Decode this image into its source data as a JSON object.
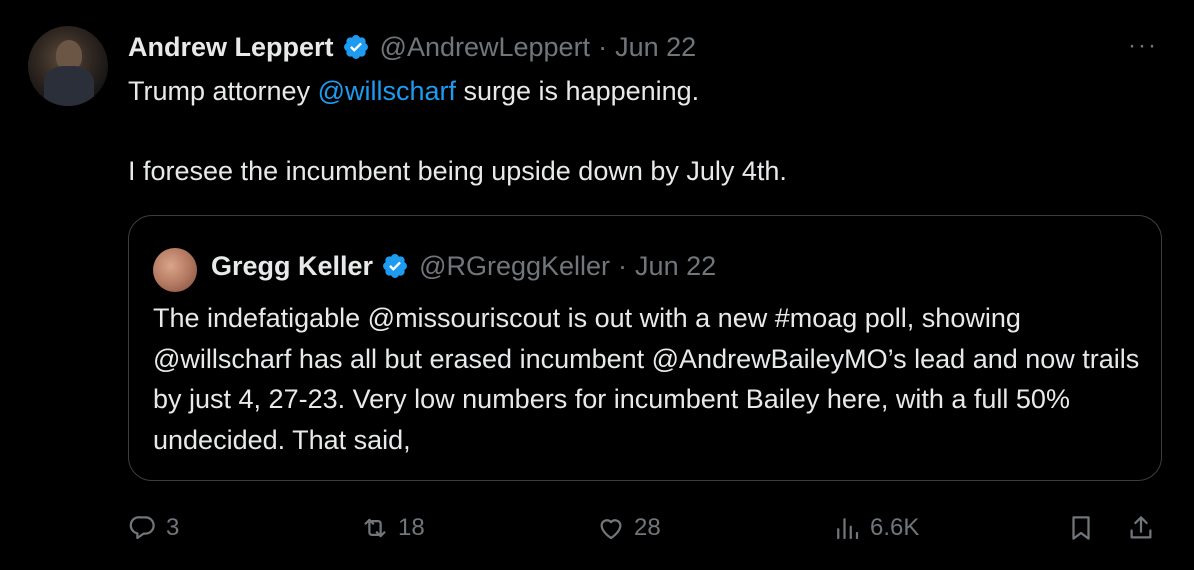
{
  "tweet": {
    "author_name": "Andrew Leppert",
    "author_handle": "@AndrewLeppert",
    "separator": "·",
    "date": "Jun 22",
    "more_icon": "more-icon",
    "text_line1_prefix": "Trump attorney ",
    "text_line1_mention": "@willscharf",
    "text_line1_suffix": " surge is happening.",
    "text_line2": "I foresee the incumbent being upside down by July 4th."
  },
  "quote": {
    "author_name": "Gregg Keller",
    "author_handle": "@RGreggKeller",
    "separator": "·",
    "date": "Jun 22",
    "text": "The indefatigable @missouriscout is out with a new #moag poll, showing @willscharf has all but erased incumbent @AndrewBaileyMO’s lead and now trails by just 4, 27-23. Very low numbers for incumbent Bailey here, with a full 50% undecided. That said,"
  },
  "actions": {
    "replies": "3",
    "reposts": "18",
    "likes": "28",
    "views": "6.6K"
  },
  "colors": {
    "background": "#000000",
    "text": "#e7e9ea",
    "muted": "#71767b",
    "link": "#1d9bf0",
    "verified": "#1d9bf0",
    "border": "#3a3e42"
  }
}
